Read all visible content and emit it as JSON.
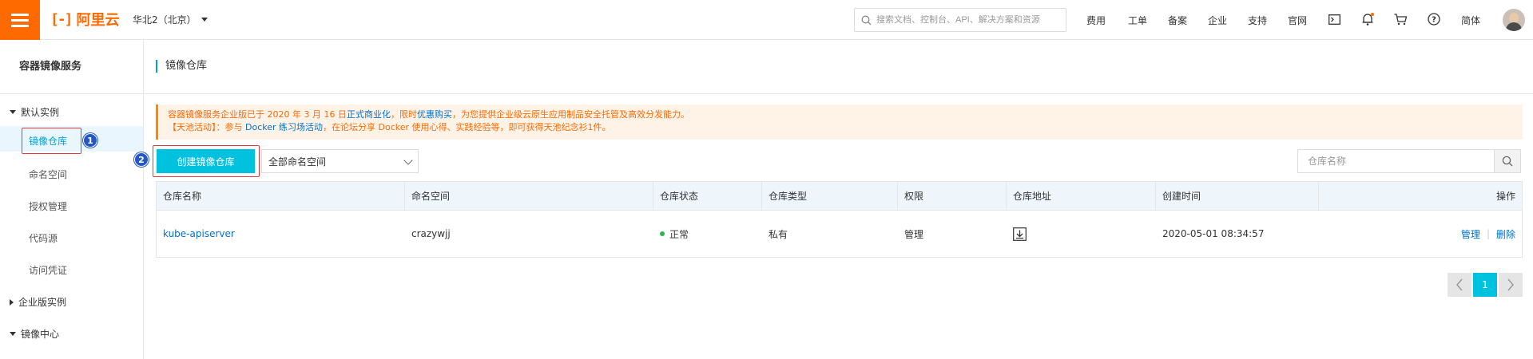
{
  "topbar": {
    "logo_text": "阿里云",
    "region": "华北2（北京）",
    "search_placeholder": "搜索文档、控制台、API、解决方案和资源",
    "nav": [
      "费用",
      "工单",
      "备案",
      "企业",
      "支持",
      "官网"
    ],
    "lang": "简体",
    "colors": {
      "brand": "#ff6a00",
      "notify_dot": "#ff6a00"
    }
  },
  "sidebar": {
    "title": "容器镜像服务",
    "groups": [
      {
        "label": "默认实例",
        "expanded": true,
        "items": [
          "镜像仓库",
          "命名空间",
          "授权管理",
          "代码源",
          "访问凭证"
        ]
      },
      {
        "label": "企业版实例",
        "expanded": false,
        "items": []
      },
      {
        "label": "镜像中心",
        "expanded": true,
        "items": []
      }
    ],
    "active_item": "镜像仓库"
  },
  "main": {
    "title": "镜像仓库",
    "notice": {
      "line1_prefix": "容器镜像服务企业版已于 2020 年 3 月 16 日",
      "line1_link1": "正式商业化",
      "line1_mid": "，限时",
      "line1_link2": "优惠购买",
      "line1_suffix": "，为您提供企业级云原生应用制品安全托管及高效分发能力。",
      "line2_prefix": "【天池活动】：参与 ",
      "line2_link": "Docker 练习场活动",
      "line2_suffix": "，在论坛分享 Docker 使用心得、实践经验等，即可获得天池纪念衫1件。"
    },
    "create_button": "创建镜像仓库",
    "namespace_select": "全部命名空间",
    "repo_search_placeholder": "仓库名称",
    "table": {
      "headers": [
        "仓库名称",
        "命名空间",
        "仓库状态",
        "仓库类型",
        "权限",
        "仓库地址",
        "创建时间",
        "操作"
      ],
      "rows": [
        {
          "name": "kube-apiserver",
          "namespace": "crazywjj",
          "status": "正常",
          "type": "私有",
          "permission": "管理",
          "address_icon": "download-icon",
          "created": "2020-05-01 08:34:57",
          "actions": [
            "管理",
            "删除"
          ]
        }
      ]
    },
    "pagination": {
      "current": "1"
    }
  },
  "annotations": {
    "badge1": "1",
    "badge2": "2"
  }
}
